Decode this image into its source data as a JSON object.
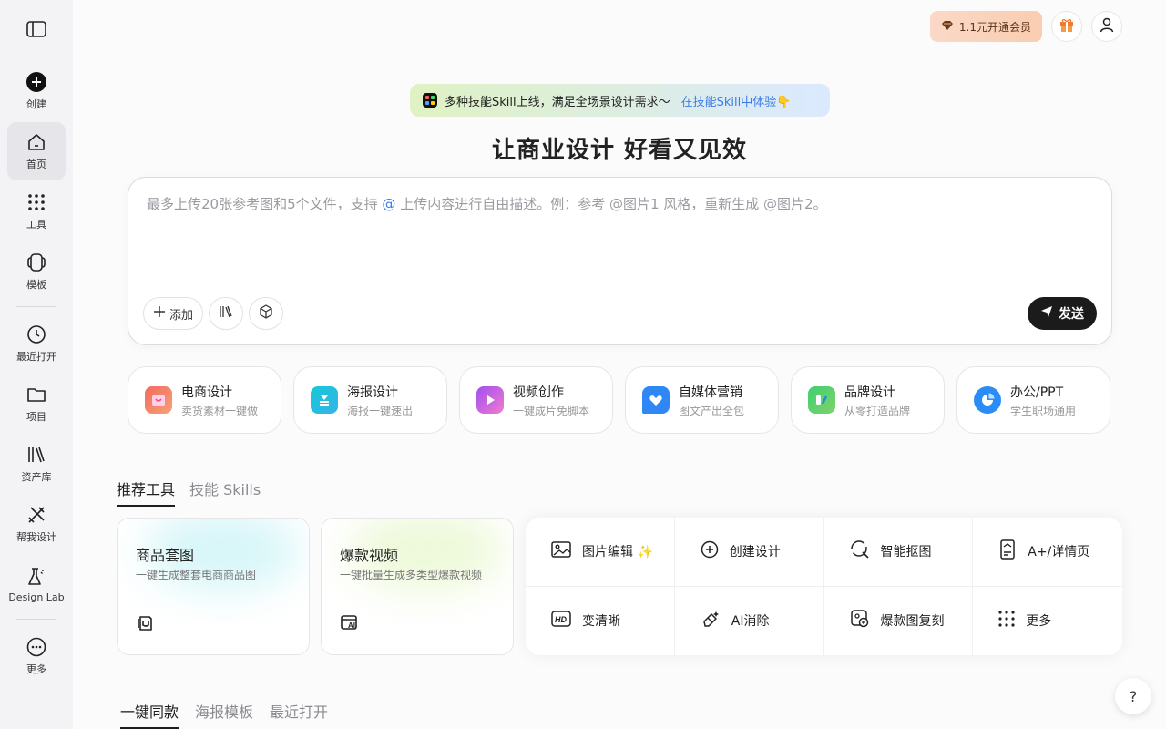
{
  "sidebar": {
    "toggle_icon": "sidebar-toggle-icon",
    "items": [
      {
        "label": "创建",
        "icon": "plus-circle-icon"
      },
      {
        "label": "首页",
        "icon": "home-icon",
        "active": true
      },
      {
        "label": "工具",
        "icon": "grid-dots-icon"
      },
      {
        "label": "模板",
        "icon": "template-icon"
      },
      {
        "label": "最近打开",
        "icon": "clock-icon"
      },
      {
        "label": "项目",
        "icon": "folder-icon"
      },
      {
        "label": "资产库",
        "icon": "library-icon"
      },
      {
        "label": "帮我设计",
        "icon": "design-tools-icon"
      },
      {
        "label": "Design Lab",
        "icon": "flask-icon"
      },
      {
        "label": "更多",
        "icon": "more-icon"
      }
    ]
  },
  "topbar": {
    "vip_label": "1.1元开通会员",
    "gift_icon": "gift-icon",
    "user_icon": "user-icon"
  },
  "banner": {
    "text": "多种技能Skill上线，满足全场景设计需求～",
    "link": "在技能Skill中体验👇"
  },
  "headline": "让商业设计 好看又见效",
  "composer": {
    "placeholder_a": "最多上传20张参考图和5个文件，支持",
    "placeholder_at": "@",
    "placeholder_b": "上传内容进行自由描述。例：参考 @图片1 风格，重新生成 @图片2。",
    "add_label": "添加",
    "send_label": "发送"
  },
  "categories": [
    {
      "title": "电商设计",
      "sub": "卖货素材一键做",
      "color": "#f47b6b"
    },
    {
      "title": "海报设计",
      "sub": "海报一键速出",
      "color": "#22c3d8"
    },
    {
      "title": "视频创作",
      "sub": "一键成片免脚本",
      "color": "#c35cf0"
    },
    {
      "title": "自媒体营销",
      "sub": "图文产出全包",
      "color": "#3b8cf5"
    },
    {
      "title": "品牌设计",
      "sub": "从零打造品牌",
      "color": "#48c97a"
    },
    {
      "title": "办公/PPT",
      "sub": "学生职场通用",
      "color": "#2f8cf7"
    }
  ],
  "tool_tabs": [
    {
      "label": "推荐工具",
      "active": true
    },
    {
      "label": "技能 Skills",
      "active": false
    }
  ],
  "tool_cards": [
    {
      "title": "商品套图",
      "sub": "一键生成整套电商商品图",
      "glow": "#bdf0f4"
    },
    {
      "title": "爆款视频",
      "sub": "一键批量生成多类型爆款视频",
      "glow": "#e2f5c0"
    }
  ],
  "tool_grid": [
    {
      "label": "图片编辑 ✨",
      "icon": "image-edit-icon"
    },
    {
      "label": "创建设计",
      "icon": "plus-square-icon"
    },
    {
      "label": "智能抠图",
      "icon": "cutout-icon"
    },
    {
      "label": "A+/详情页",
      "icon": "detail-page-icon"
    },
    {
      "label": "变清晰",
      "icon": "hd-icon"
    },
    {
      "label": "AI消除",
      "icon": "eraser-icon"
    },
    {
      "label": "爆款图复刻",
      "icon": "replicate-icon"
    },
    {
      "label": "更多",
      "icon": "more-dots-icon"
    }
  ],
  "bottom_tabs": [
    {
      "label": "一键同款",
      "active": true
    },
    {
      "label": "海报模板",
      "active": false
    },
    {
      "label": "最近打开",
      "active": false
    }
  ],
  "help_label": "?"
}
